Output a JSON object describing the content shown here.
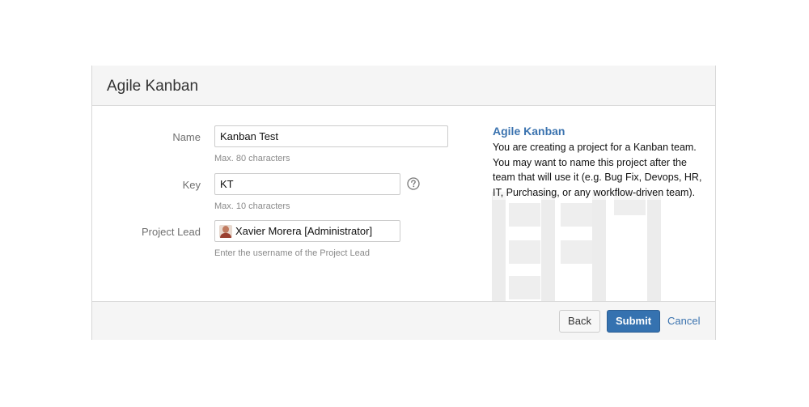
{
  "dialog": {
    "title": "Agile Kanban"
  },
  "form": {
    "name": {
      "label": "Name",
      "value": "Kanban Test",
      "hint": "Max. 80 characters"
    },
    "key": {
      "label": "Key",
      "value": "KT",
      "hint": "Max. 10 characters",
      "help_icon": "question-circle-icon"
    },
    "project_lead": {
      "label": "Project Lead",
      "value": "Xavier Morera [Administrator]",
      "hint": "Enter the username of the Project Lead",
      "avatar_icon": "user-avatar-icon"
    }
  },
  "side_panel": {
    "title": "Agile Kanban",
    "description": "You are creating a project for a Kanban team. You may want to name this project after the team that will use it (e.g. Bug Fix, Devops, HR, IT, Purchasing, or any workflow-driven team)."
  },
  "footer": {
    "back_label": "Back",
    "submit_label": "Submit",
    "cancel_label": "Cancel"
  },
  "colors": {
    "accent": "#3572b0",
    "link": "#3b73af",
    "header_bg": "#f5f5f5"
  }
}
